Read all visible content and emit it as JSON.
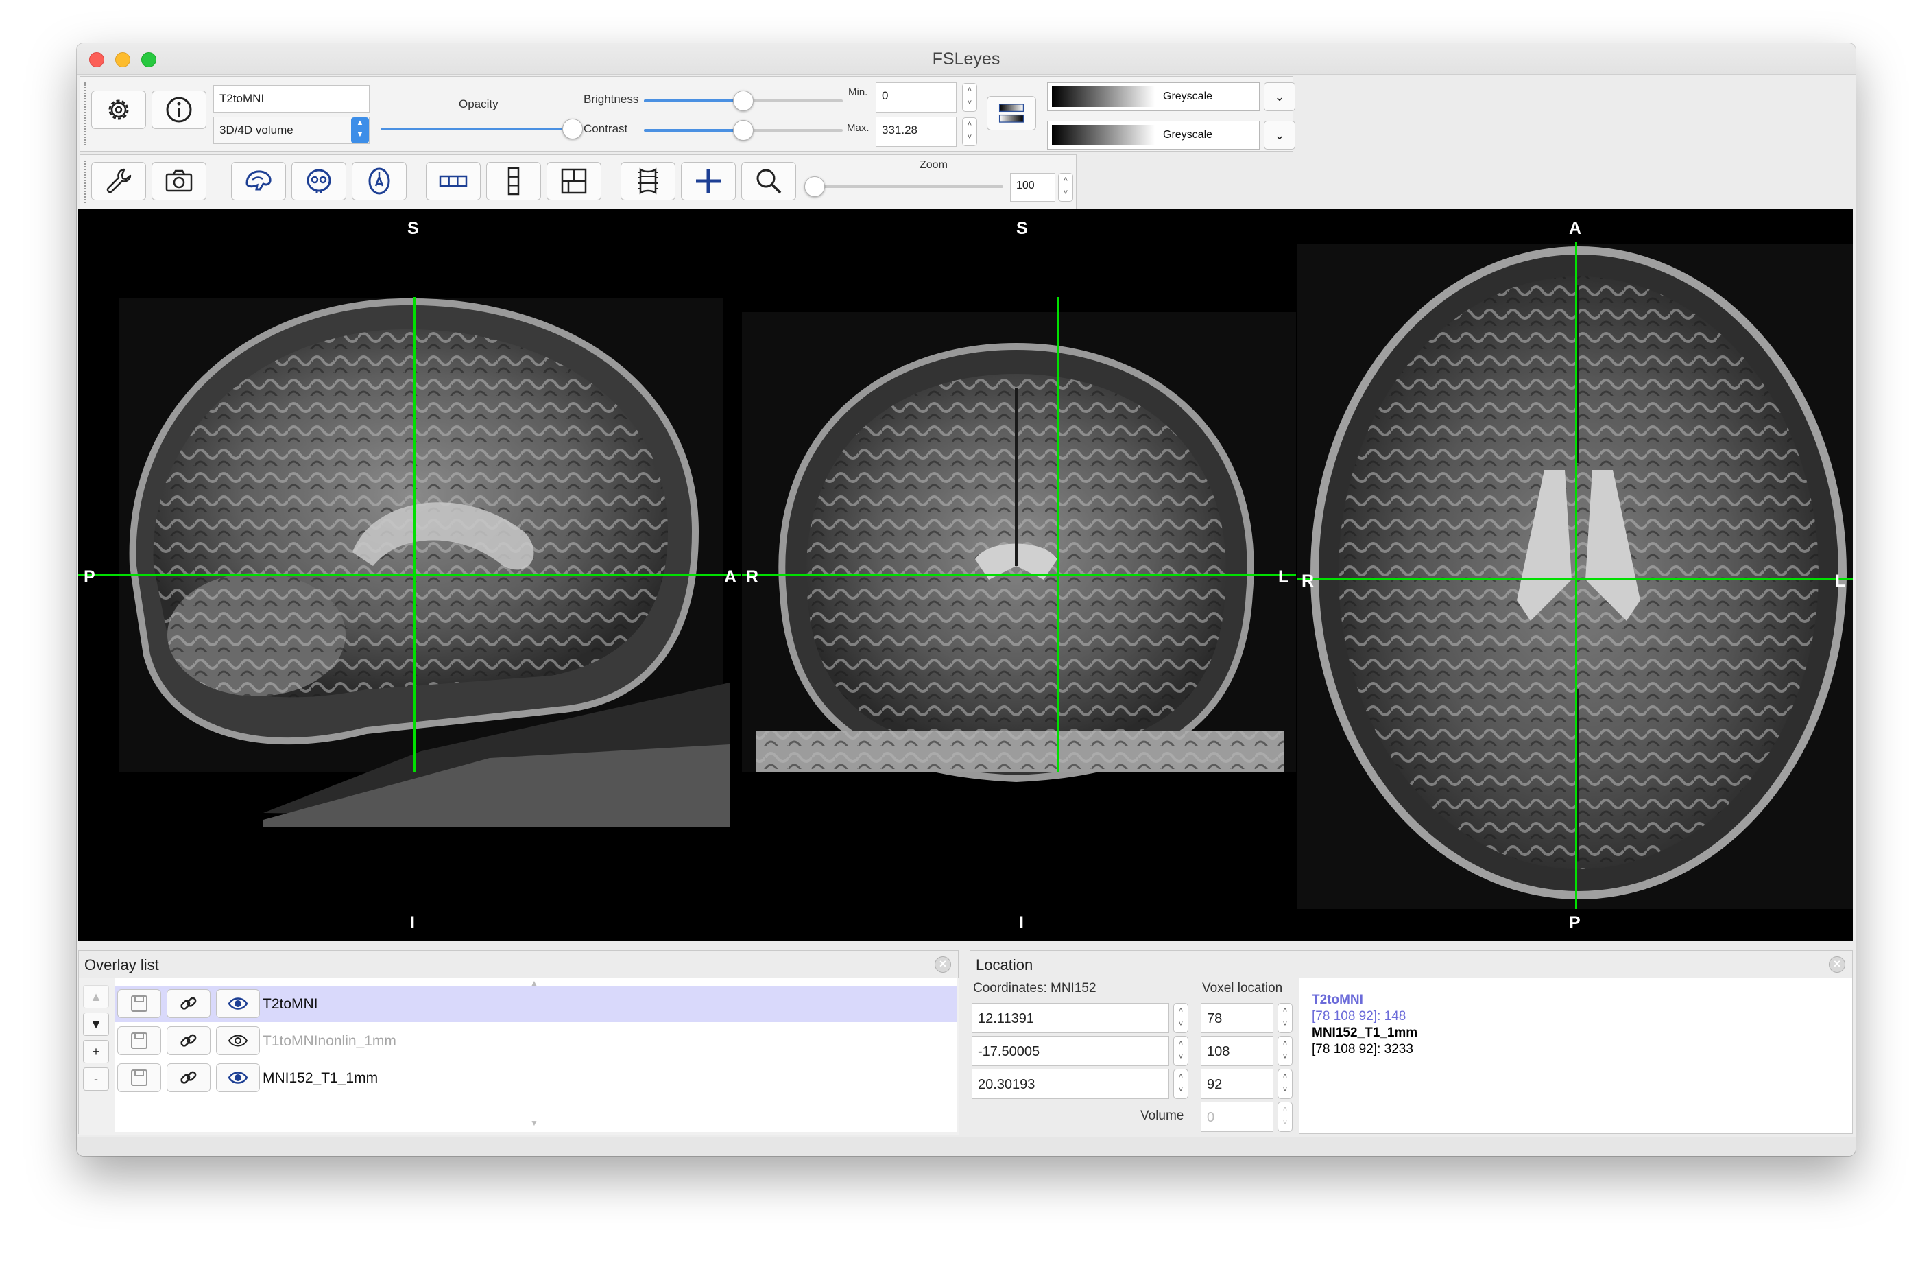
{
  "window": {
    "title": "FSLeyes"
  },
  "overlay_toolbar": {
    "overlay_name": "T2toMNI",
    "overlay_type": "3D/4D volume",
    "opacity_label": "Opacity",
    "opacity_value": 1.0,
    "brightness_label": "Brightness",
    "brightness_value": 0.5,
    "contrast_label": "Contrast",
    "contrast_value": 0.5,
    "min_label": "Min.",
    "min_value": "0",
    "max_label": "Max.",
    "max_value": "331.28",
    "colormap_1": "Greyscale",
    "colormap_2": "Greyscale"
  },
  "ortho_toolbar": {
    "zoom_label": "Zoom",
    "zoom_value": "100",
    "buttons": [
      "settings-wrench",
      "screenshot",
      "toggle-sagittal",
      "toggle-coronal",
      "toggle-axial",
      "layout-horizontal",
      "layout-vertical",
      "layout-grid",
      "movie-mode",
      "toggle-cursor",
      "reset-zoom"
    ]
  },
  "views": {
    "sagittal": {
      "top": "S",
      "bottom": "I",
      "left": "P",
      "right": "A"
    },
    "coronal": {
      "top": "S",
      "bottom": "I",
      "left": "R",
      "right": "L"
    },
    "axial": {
      "top": "A",
      "bottom": "P",
      "left": "R",
      "right": "L"
    },
    "cursor_color": "#00e000"
  },
  "overlay_list": {
    "title": "Overlay list",
    "items": [
      {
        "name": "T2toMNI",
        "visible": true,
        "selected": true
      },
      {
        "name": "T1toMNInonlin_1mm",
        "visible": false,
        "selected": false
      },
      {
        "name": "MNI152_T1_1mm",
        "visible": true,
        "selected": false
      }
    ],
    "side_buttons": [
      "▲",
      "▼",
      "+",
      "-"
    ]
  },
  "location": {
    "title": "Location",
    "coord_label": "Coordinates: MNI152",
    "voxel_label": "Voxel location",
    "coords": [
      "12.11391",
      "-17.50005",
      "20.30193"
    ],
    "voxels": [
      "78",
      "108",
      "92"
    ],
    "volume_label": "Volume",
    "volume_value": "0",
    "info": [
      {
        "name": "T2toMNI",
        "value": "[78 108 92]: 148",
        "color": "#6b6bd9"
      },
      {
        "name": "MNI152_T1_1mm",
        "value": "[78 108 92]: 3233",
        "color": "#000000"
      }
    ]
  }
}
